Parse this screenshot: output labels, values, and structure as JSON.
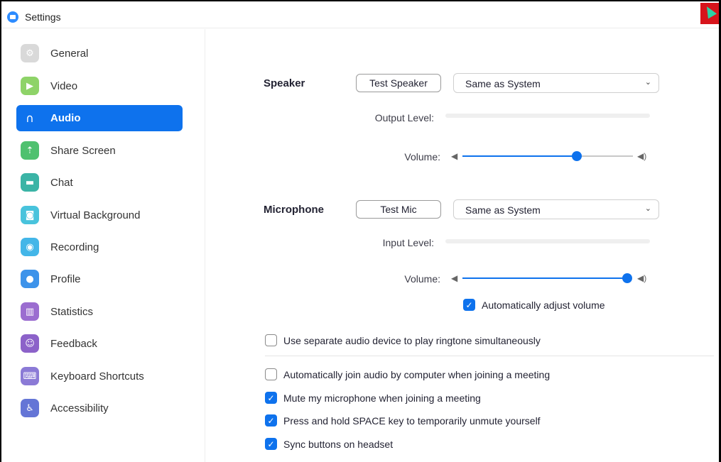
{
  "window": {
    "title": "Settings"
  },
  "sidebar": {
    "items": [
      {
        "label": "General",
        "icon": "gear-icon",
        "color": "#d9d9d9",
        "glyph": "⚙",
        "active": false
      },
      {
        "label": "Video",
        "icon": "video-camera-icon",
        "color": "#8ed368",
        "glyph": "▶",
        "active": false
      },
      {
        "label": "Audio",
        "icon": "headphones-icon",
        "color": "#0e72ed",
        "glyph": "∩",
        "active": true
      },
      {
        "label": "Share Screen",
        "icon": "share-screen-icon",
        "color": "#4fc16f",
        "glyph": "⇡",
        "active": false
      },
      {
        "label": "Chat",
        "icon": "chat-bubble-icon",
        "color": "#3bb4a6",
        "glyph": "▬",
        "active": false
      },
      {
        "label": "Virtual Background",
        "icon": "person-background-icon",
        "color": "#48c3dc",
        "glyph": "◙",
        "active": false
      },
      {
        "label": "Recording",
        "icon": "record-icon",
        "color": "#43b6e8",
        "glyph": "◉",
        "active": false
      },
      {
        "label": "Profile",
        "icon": "user-profile-icon",
        "color": "#3d93ea",
        "glyph": "●",
        "active": false
      },
      {
        "label": "Statistics",
        "icon": "bar-chart-icon",
        "color": "#9b6dd0",
        "glyph": "▥",
        "active": false
      },
      {
        "label": "Feedback",
        "icon": "smiley-face-icon",
        "color": "#8c62c9",
        "glyph": "☺",
        "active": false
      },
      {
        "label": "Keyboard Shortcuts",
        "icon": "keyboard-icon",
        "color": "#8b7ad6",
        "glyph": "⌨",
        "active": false
      },
      {
        "label": "Accessibility",
        "icon": "accessibility-icon",
        "color": "#6475d6",
        "glyph": "♿",
        "active": false
      }
    ]
  },
  "speaker": {
    "label": "Speaker",
    "test_button": "Test Speaker",
    "device": "Same as System",
    "output_level_label": "Output Level:",
    "volume_label": "Volume:",
    "volume": 0.67
  },
  "microphone": {
    "label": "Microphone",
    "test_button": "Test Mic",
    "device": "Same as System",
    "input_level_label": "Input Level:",
    "volume_label": "Volume:",
    "volume": 1.0,
    "auto_adjust_label": "Automatically adjust volume",
    "auto_adjust": true
  },
  "options": [
    {
      "label": "Use separate audio device to play ringtone simultaneously",
      "checked": false
    },
    {
      "label": "Automatically join audio by computer when joining a meeting",
      "checked": false
    },
    {
      "label": "Mute my microphone when joining a meeting",
      "checked": true
    },
    {
      "label": "Press and hold SPACE key to temporarily unmute yourself",
      "checked": true
    },
    {
      "label": "Sync buttons on headset",
      "checked": true
    }
  ],
  "colors": {
    "accent": "#0e72ed"
  }
}
